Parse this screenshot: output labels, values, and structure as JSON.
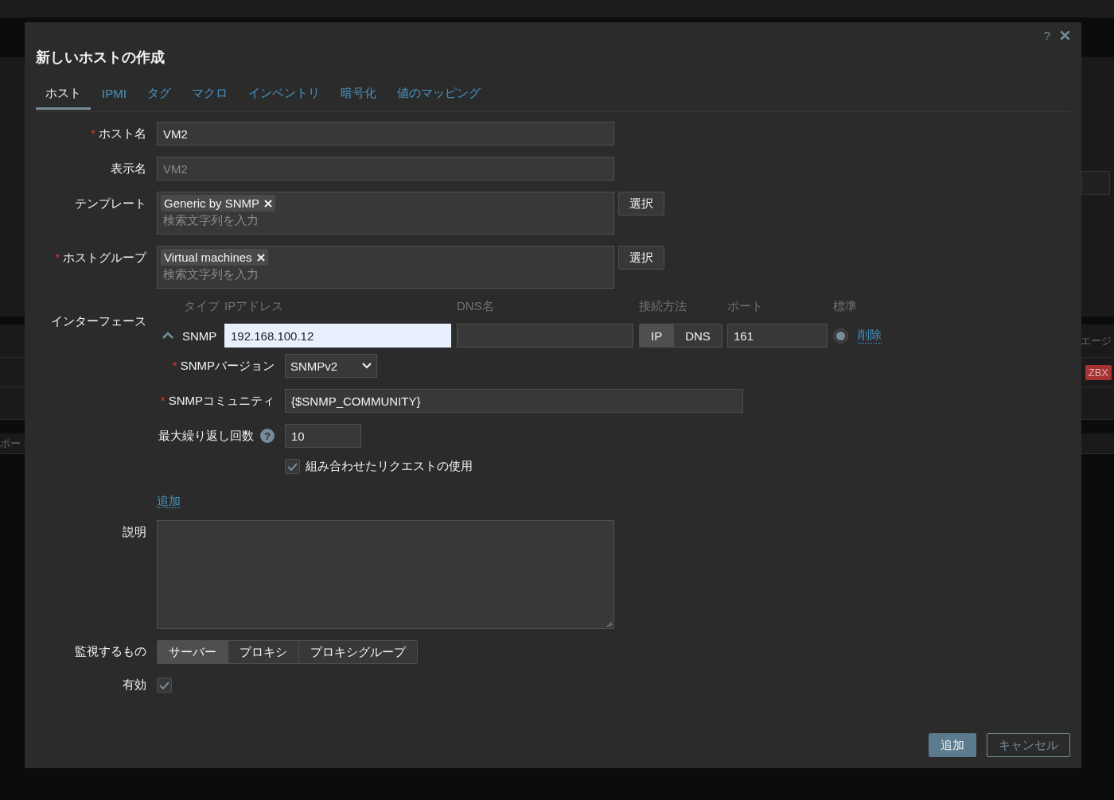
{
  "background": {
    "header_fragment": "エージ",
    "badge": "ZBX",
    "left_fragment": "ポー"
  },
  "dialog": {
    "title": "新しいホストの作成",
    "help": "?"
  },
  "tabs": [
    {
      "label": "ホスト",
      "selected": true
    },
    {
      "label": "IPMI",
      "selected": false
    },
    {
      "label": "タグ",
      "selected": false
    },
    {
      "label": "マクロ",
      "selected": false
    },
    {
      "label": "インベントリ",
      "selected": false
    },
    {
      "label": "暗号化",
      "selected": false
    },
    {
      "label": "値のマッピング",
      "selected": false
    }
  ],
  "host_name": {
    "label": "ホスト名",
    "required_mark": "*",
    "value": "VM2"
  },
  "display_name": {
    "label": "表示名",
    "placeholder": "VM2"
  },
  "templates": {
    "label": "テンプレート",
    "tags": [
      "Generic by SNMP"
    ],
    "placeholder": "検索文字列を入力",
    "button": "選択"
  },
  "host_groups": {
    "label": "ホストグループ",
    "required_mark": "*",
    "tags": [
      "Virtual machines"
    ],
    "placeholder": "検索文字列を入力",
    "button": "選択"
  },
  "interfaces": {
    "label": "インターフェース",
    "columns": [
      "タイプ",
      "IPアドレス",
      "DNS名",
      "接続方法",
      "ポート",
      "標準"
    ],
    "items": [
      {
        "type": "SNMP",
        "expanded": true,
        "ip": "192.168.100.12",
        "connect": [
          {
            "label": "IP",
            "selected": true
          },
          {
            "label": "DNS",
            "selected": false
          }
        ],
        "port": "161",
        "default": true,
        "remove": "削除",
        "version": {
          "label": "SNMPバージョン",
          "required_mark": "*",
          "value": "SNMPv2"
        },
        "community": {
          "label": "SNMPコミュニティ",
          "required_mark": "*",
          "value": "{$SNMP_COMMUNITY}"
        },
        "max_repetitions": {
          "label": "最大繰り返し回数",
          "help": "?",
          "value": "10"
        },
        "bulk": {
          "label": "組み合わせたリクエストの使用",
          "checked": true
        }
      }
    ],
    "add": "追加"
  },
  "description": {
    "label": "説明"
  },
  "monitored_by": {
    "label": "監視するもの",
    "options": [
      {
        "label": "サーバー",
        "selected": true
      },
      {
        "label": "プロキシ",
        "selected": false
      },
      {
        "label": "プロキシグループ",
        "selected": false
      }
    ]
  },
  "enabled": {
    "label": "有効",
    "checked": true
  },
  "buttons": [
    {
      "label": "追加",
      "kind": "primary"
    },
    {
      "label": "キャンセル",
      "kind": "secondary"
    }
  ]
}
